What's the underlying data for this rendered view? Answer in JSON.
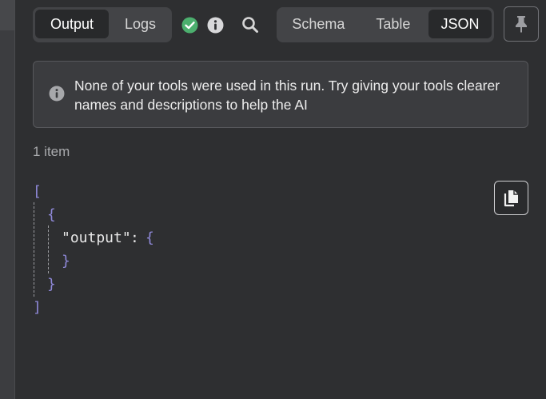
{
  "toolbar": {
    "view_tabs": [
      {
        "label": "Output",
        "active": true
      },
      {
        "label": "Logs",
        "active": false
      }
    ],
    "status_icon": "check-circle-icon",
    "info_icon": "info-icon",
    "search_icon": "search-icon",
    "format_tabs": [
      {
        "label": "Schema",
        "active": false
      },
      {
        "label": "Table",
        "active": false
      },
      {
        "label": "JSON",
        "active": true
      }
    ],
    "pin_icon": "pin-icon"
  },
  "notice": {
    "icon": "info-icon",
    "text": "None of your tools were used in this run. Try giving your tools clearer names and descriptions to help the AI"
  },
  "item_count": "1 item",
  "copy_icon": "copy-icon",
  "json_view": {
    "open_array": "[",
    "open_object": "{",
    "key": "\"output\"",
    "colon": ":",
    "inner_open": "{",
    "inner_close": "}",
    "close_object": "}",
    "close_array": "]"
  },
  "colors": {
    "background": "#2e2f31",
    "bracket": "#8f89d9",
    "success": "#4caf6e"
  }
}
